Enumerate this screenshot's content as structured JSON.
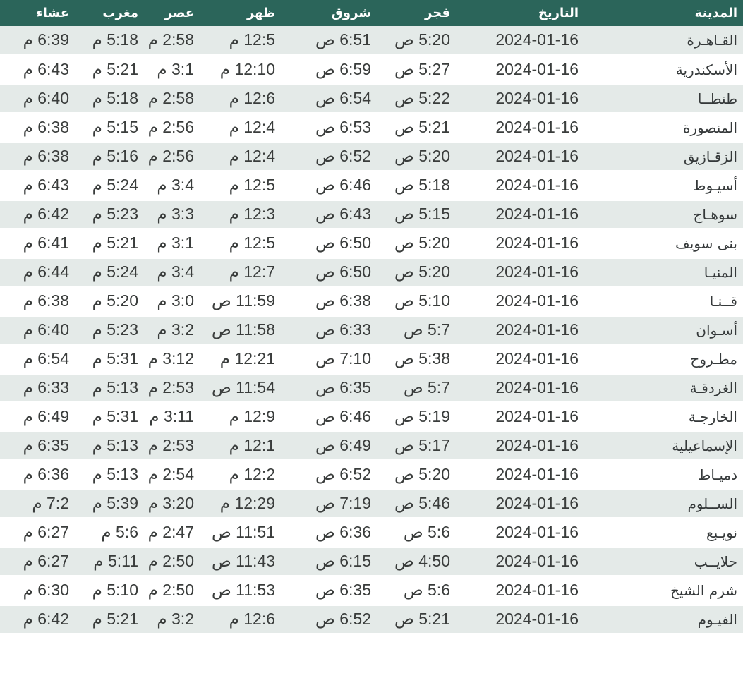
{
  "colors": {
    "header_background": "#2b655a",
    "header_text": "#ffffff",
    "row_stripe": "#e4eae8",
    "row_plain": "#ffffff",
    "body_text": "#3a3d3c"
  },
  "table": {
    "headers": {
      "city": "المدينة",
      "date": "التاريخ",
      "fajr": "فجر",
      "sunrise": "شروق",
      "dhuhr": "ظهر",
      "asr": "عصر",
      "maghrib": "مغرب",
      "isha": "عشاء"
    },
    "rows": [
      {
        "city": "القـاهـرة",
        "date": "2024-01-16",
        "fajr": "5:20 ص",
        "sunrise": "6:51 ص",
        "dhuhr": "12:5 م",
        "asr": "2:58 م",
        "maghrib": "5:18 م",
        "isha": "6:39 م"
      },
      {
        "city": "الأسكندرية",
        "date": "2024-01-16",
        "fajr": "5:27 ص",
        "sunrise": "6:59 ص",
        "dhuhr": "12:10 م",
        "asr": "3:1 م",
        "maghrib": "5:21 م",
        "isha": "6:43 م"
      },
      {
        "city": "طنطــا",
        "date": "2024-01-16",
        "fajr": "5:22 ص",
        "sunrise": "6:54 ص",
        "dhuhr": "12:6 م",
        "asr": "2:58 م",
        "maghrib": "5:18 م",
        "isha": "6:40 م"
      },
      {
        "city": "المنصورة",
        "date": "2024-01-16",
        "fajr": "5:21 ص",
        "sunrise": "6:53 ص",
        "dhuhr": "12:4 م",
        "asr": "2:56 م",
        "maghrib": "5:15 م",
        "isha": "6:38 م"
      },
      {
        "city": "الزقـازيق",
        "date": "2024-01-16",
        "fajr": "5:20 ص",
        "sunrise": "6:52 ص",
        "dhuhr": "12:4 م",
        "asr": "2:56 م",
        "maghrib": "5:16 م",
        "isha": "6:38 م"
      },
      {
        "city": "أسيـوط",
        "date": "2024-01-16",
        "fajr": "5:18 ص",
        "sunrise": "6:46 ص",
        "dhuhr": "12:5 م",
        "asr": "3:4 م",
        "maghrib": "5:24 م",
        "isha": "6:43 م"
      },
      {
        "city": "سوهـاج",
        "date": "2024-01-16",
        "fajr": "5:15 ص",
        "sunrise": "6:43 ص",
        "dhuhr": "12:3 م",
        "asr": "3:3 م",
        "maghrib": "5:23 م",
        "isha": "6:42 م"
      },
      {
        "city": "بنى سويف",
        "date": "2024-01-16",
        "fajr": "5:20 ص",
        "sunrise": "6:50 ص",
        "dhuhr": "12:5 م",
        "asr": "3:1 م",
        "maghrib": "5:21 م",
        "isha": "6:41 م"
      },
      {
        "city": "المنيـا",
        "date": "2024-01-16",
        "fajr": "5:20 ص",
        "sunrise": "6:50 ص",
        "dhuhr": "12:7 م",
        "asr": "3:4 م",
        "maghrib": "5:24 م",
        "isha": "6:44 م"
      },
      {
        "city": "قــنـا",
        "date": "2024-01-16",
        "fajr": "5:10 ص",
        "sunrise": "6:38 ص",
        "dhuhr": "11:59 ص",
        "asr": "3:0 م",
        "maghrib": "5:20 م",
        "isha": "6:38 م"
      },
      {
        "city": "أسـوان",
        "date": "2024-01-16",
        "fajr": "5:7 ص",
        "sunrise": "6:33 ص",
        "dhuhr": "11:58 ص",
        "asr": "3:2 م",
        "maghrib": "5:23 م",
        "isha": "6:40 م"
      },
      {
        "city": "مطـروح",
        "date": "2024-01-16",
        "fajr": "5:38 ص",
        "sunrise": "7:10 ص",
        "dhuhr": "12:21 م",
        "asr": "3:12 م",
        "maghrib": "5:31 م",
        "isha": "6:54 م"
      },
      {
        "city": "الغردقـة",
        "date": "2024-01-16",
        "fajr": "5:7 ص",
        "sunrise": "6:35 ص",
        "dhuhr": "11:54 ص",
        "asr": "2:53 م",
        "maghrib": "5:13 م",
        "isha": "6:33 م"
      },
      {
        "city": "الخارجـة",
        "date": "2024-01-16",
        "fajr": "5:19 ص",
        "sunrise": "6:46 ص",
        "dhuhr": "12:9 م",
        "asr": "3:11 م",
        "maghrib": "5:31 م",
        "isha": "6:49 م"
      },
      {
        "city": "الإسماعيلية",
        "date": "2024-01-16",
        "fajr": "5:17 ص",
        "sunrise": "6:49 ص",
        "dhuhr": "12:1 م",
        "asr": "2:53 م",
        "maghrib": "5:13 م",
        "isha": "6:35 م"
      },
      {
        "city": "دميـاط",
        "date": "2024-01-16",
        "fajr": "5:20 ص",
        "sunrise": "6:52 ص",
        "dhuhr": "12:2 م",
        "asr": "2:54 م",
        "maghrib": "5:13 م",
        "isha": "6:36 م"
      },
      {
        "city": "الســلوم",
        "date": "2024-01-16",
        "fajr": "5:46 ص",
        "sunrise": "7:19 ص",
        "dhuhr": "12:29 م",
        "asr": "3:20 م",
        "maghrib": "5:39 م",
        "isha": "7:2 م"
      },
      {
        "city": "نويـبع",
        "date": "2024-01-16",
        "fajr": "5:6 ص",
        "sunrise": "6:36 ص",
        "dhuhr": "11:51 ص",
        "asr": "2:47 م",
        "maghrib": "5:6 م",
        "isha": "6:27 م"
      },
      {
        "city": "حلايــب",
        "date": "2024-01-16",
        "fajr": "4:50 ص",
        "sunrise": "6:15 ص",
        "dhuhr": "11:43 ص",
        "asr": "2:50 م",
        "maghrib": "5:11 م",
        "isha": "6:27 م"
      },
      {
        "city": "شرم الشيخ",
        "date": "2024-01-16",
        "fajr": "5:6 ص",
        "sunrise": "6:35 ص",
        "dhuhr": "11:53 ص",
        "asr": "2:50 م",
        "maghrib": "5:10 م",
        "isha": "6:30 م"
      },
      {
        "city": "الفيـوم",
        "date": "2024-01-16",
        "fajr": "5:21 ص",
        "sunrise": "6:52 ص",
        "dhuhr": "12:6 م",
        "asr": "3:2 م",
        "maghrib": "5:21 م",
        "isha": "6:42 م"
      }
    ]
  }
}
